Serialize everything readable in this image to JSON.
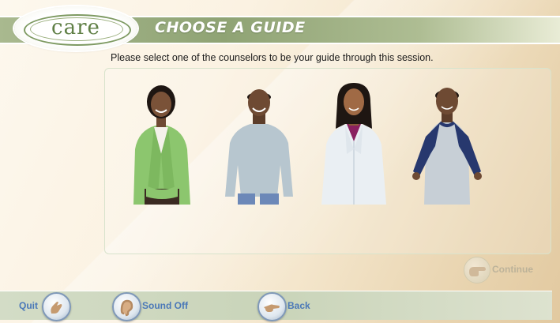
{
  "app": {
    "logo_text": "care",
    "title": "CHOOSE A GUIDE"
  },
  "instruction": "Please select one of the counselors to be your guide through this session.",
  "counselors": [
    {
      "id": "counselor-1",
      "icon": "woman-green-jacket"
    },
    {
      "id": "counselor-2",
      "icon": "man-grey-sweater"
    },
    {
      "id": "counselor-3",
      "icon": "woman-white-coat"
    },
    {
      "id": "counselor-4",
      "icon": "man-raglan-shirt"
    }
  ],
  "buttons": {
    "continue": "Continue",
    "quit": "Quit",
    "sound": "Sound Off",
    "back": "Back"
  },
  "colors": {
    "header_green": "#8fa374",
    "nav_blue": "#4a78b8"
  }
}
